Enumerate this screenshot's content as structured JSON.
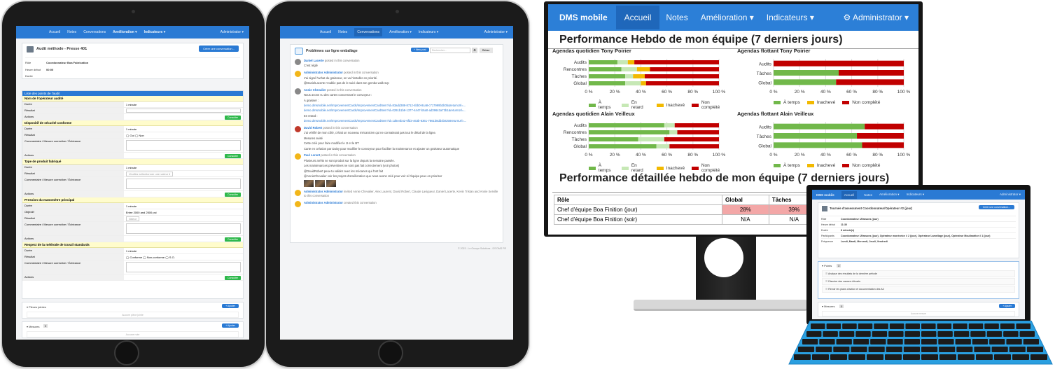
{
  "tablet1": {
    "nav": [
      "Accueil",
      "Notes",
      "Conversations",
      "Amélioration ▾",
      "Indicateurs ▾"
    ],
    "user": "Administrator ▾",
    "title": "Audit méthode - Presse 401",
    "create_btn": "Créer une conversation...",
    "role_label": "Rôle",
    "role_value": "Coordonnateur Boa Fabrication",
    "start_label": "Heure début",
    "start_value": "00:00",
    "duration_label": "Durée",
    "list_header": "Liste des points de l'audit",
    "sections": [
      {
        "title": "Nom de l'opérateur audité",
        "rows": [
          [
            "Durée",
            "1 minute"
          ],
          [
            "Résultat",
            ""
          ],
          [
            "Actions",
            ""
          ]
        ]
      },
      {
        "title": "Dispositif de sécurité conforme",
        "rows": [
          [
            "Durée",
            "1 minute"
          ],
          [
            "Résultat",
            "◯ Oui ◯ Non"
          ],
          [
            "Commentaire / Mesure corrective / Échéance",
            ""
          ],
          [
            "Actions",
            ""
          ]
        ]
      },
      {
        "title": "Type de produit fabriqué",
        "rows": [
          [
            "Durée",
            "1 minute"
          ],
          [
            "Résultat",
            "Veuillez sélectionner une valeur ▾"
          ],
          [
            "Commentaire / Mesure corrective / Échéance",
            ""
          ],
          [
            "Actions",
            ""
          ]
        ]
      },
      {
        "title": "Pression du manomètre principal",
        "rows": [
          [
            "Durée",
            "1 minute"
          ],
          [
            "Objectif",
            "Entre 2000 and 2500 psi"
          ],
          [
            "Résultat",
            "Valeur"
          ],
          [
            "Commentaire / Mesure corrective / Échéance",
            ""
          ],
          [
            "Actions",
            ""
          ]
        ]
      },
      {
        "title": "Respect de la méthode de travail standards",
        "rows": [
          [
            "Durée",
            "1 minute"
          ],
          [
            "Résultat",
            "◯ Conforme ◯ Non-conforme ◯ S.O."
          ],
          [
            "Commentaire / Mesure corrective / Échéance",
            ""
          ],
          [
            "Actions",
            ""
          ]
        ]
      }
    ],
    "consult": "Consulter",
    "pieces": "▾ Pièces jointes",
    "no_pieces": "Aucune pièce jointe",
    "mesures": "▾ Mesures",
    "mesures_count": "0",
    "no_mesures": "Aucune note",
    "add": "+ Ajouter"
  },
  "tablet2": {
    "nav": [
      "Accueil",
      "Notes",
      "Conversations",
      "Amélioration ▾",
      "Indicateurs ▾"
    ],
    "user": "Administrator ▾",
    "title": "Problèmes sur ligne emballage",
    "new_post": "+ New post",
    "search_placeholder": "Rechercher...",
    "back": "Retour",
    "posts": [
      {
        "author": "Daniel Lacerte",
        "meta": "posted in this conversation",
        "lines": [
          "C'est réglé"
        ],
        "color": "#888"
      },
      {
        "author": "Administrator Administrator",
        "meta": "posted in this conversation",
        "lines": [
          "J'ai signé l'achat du graisseur, on va l'installer en priorité.",
          "@DanielLacerte n'oublie pas de le suivi dans ton gemba walk svp"
        ],
        "color": "#f2b619"
      },
      {
        "author": "Annie Chevalier",
        "meta": "posted in this conversation",
        "lines": [
          "Nous avons vu des cartes concernant le convoyeur :",
          "À graisser :",
          "demo.dmsmobile.net/ImprovementCards/ImprovementCardItem?id=83add388-8712-4bb0-8ca8-c717999b2b0b&returnUrl=...",
          "demo.dmsmobile.net/ImprovementCards/ImprovementCardItem?id=0291b1b8-1377-4447-b5a0-ad39643a73b1&returnUrl=...",
          "En retard :",
          "demo.dmsmobile.net/ImprovementCards/ImprovementCardItem?id=1d6e4b42-0fd3-463b-8361-7861b8dd4b0258returnUrl=..."
        ],
        "color": "#888"
      },
      {
        "author": "David Robert",
        "meta": "posted in this conversation",
        "lines": [
          "J'ai vérifié de mon côté, c'était un nouveau mécanicien qui ne connaissait pas tout le détail de la ligne.",
          "Mesures avisé",
          "Cette créé pour faire modifier le JI et le BT",
          "Carte en création par Daisy pour modifier le convoyeur pour faciliter la maintenance et ajouter un graisseur automatique"
        ],
        "color": "#c0392b"
      },
      {
        "author": "Paul Lorent",
        "meta": "posted in this conversation",
        "lines": [
          "Plusieurs arrêts se sont produit sur la ligne depuis la semaine passée.",
          "Les maintenances préventives ne sont pas fait correctement (voir photos)",
          "@DavidRobert peux-tu valider avec les mécanos qui l'ont fait",
          "@AnnieChevalier voir les projets d'amélioration que nous avons créé pour voir si l'équipe peux en prioriser"
        ],
        "color": "#f2b619"
      },
      {
        "author": "Administrator Administrator",
        "meta": "invited Annie Chevalier, Alex Laurent, David Robert, Claude Lavigueur, Daniel Lacerte, Kevin Tristan and Annie Serville to this conversation",
        "lines": [],
        "color": "#f2b619"
      },
      {
        "author": "Administrator Administrator",
        "meta": "created this conversation",
        "lines": [],
        "color": "#f2b619"
      }
    ],
    "footer": "© 2023 - Le Groupe Solutions - DS DMS PR"
  },
  "monitor": {
    "brand": "DMS mobile",
    "nav": [
      "Accueil",
      "Notes",
      "Amélioration ▾",
      "Indicateurs ▾"
    ],
    "user": "⚙ Administrator ▾",
    "page_title": "Performance Hebdo de mon équipe (7 derniers jours)",
    "section2_title": "Performance détaillée hebdo de mon équipe (7 derniers jours)",
    "table_headers": [
      "Rôle",
      "Global",
      "Tâches"
    ],
    "table_rows": [
      [
        "Chef d'équipe Boa Finition (jour)",
        "28%",
        "39%"
      ],
      [
        "Chef d'équipe Boa Finition (soir)",
        "N/A",
        "N/A"
      ]
    ],
    "legend": {
      "on_time": "À temps",
      "late": "En retard",
      "incomplete": "Inachevé",
      "not_done": "Non complété"
    },
    "colors": {
      "on_time": "#71b84a",
      "late": "#c6e8b5",
      "incomplete": "#f2b900",
      "not_done": "#c10000"
    }
  },
  "chart_data": [
    {
      "type": "bar",
      "orientation": "horizontal",
      "stacked": true,
      "title": "Agendas quotidien Tony Poirier",
      "categories": [
        "Audits",
        "Rencontres",
        "Tâches",
        "Global"
      ],
      "xlim": [
        0,
        100
      ],
      "xticks": [
        "0 %",
        "20 %",
        "40 %",
        "60 %",
        "80 %",
        "100 %"
      ],
      "series": [
        {
          "name": "À temps",
          "values": [
            22,
            25,
            28,
            28
          ]
        },
        {
          "name": "En retard",
          "values": [
            8,
            12,
            6,
            12
          ]
        },
        {
          "name": "Inachevé",
          "values": [
            5,
            10,
            9,
            4
          ]
        },
        {
          "name": "Non complété",
          "values": [
            65,
            53,
            57,
            56
          ]
        }
      ]
    },
    {
      "type": "bar",
      "orientation": "horizontal",
      "stacked": true,
      "title": "Agendas flottant Tony Poirier",
      "categories": [
        "Audits",
        "Tâches",
        "Global"
      ],
      "xlim": [
        0,
        100
      ],
      "xticks": [
        "0 %",
        "20 %",
        "40 %",
        "60 %",
        "80 %",
        "100 %"
      ],
      "series": [
        {
          "name": "À temps",
          "values": [
            0,
            50,
            48
          ]
        },
        {
          "name": "Inachevé",
          "values": [
            0,
            0,
            0
          ]
        },
        {
          "name": "Non complété",
          "values": [
            100,
            50,
            52
          ]
        }
      ]
    },
    {
      "type": "bar",
      "orientation": "horizontal",
      "stacked": true,
      "title": "Agendas quotidien Alain Veilleux",
      "categories": [
        "Audits",
        "Rencontres",
        "Tâches",
        "Global"
      ],
      "xlim": [
        0,
        100
      ],
      "xticks": [
        "0 %",
        "20 %",
        "40 %",
        "60 %",
        "80 %",
        "100 %"
      ],
      "series": [
        {
          "name": "À temps",
          "values": [
            58,
            62,
            38,
            52
          ]
        },
        {
          "name": "En retard",
          "values": [
            8,
            6,
            20,
            10
          ]
        },
        {
          "name": "Inachevé",
          "values": [
            0,
            0,
            0,
            0
          ]
        },
        {
          "name": "Non complété",
          "values": [
            34,
            32,
            42,
            38
          ]
        }
      ]
    },
    {
      "type": "bar",
      "orientation": "horizontal",
      "stacked": true,
      "title": "Agendas flottant Alain Veilleux",
      "categories": [
        "Audits",
        "Tâches",
        "Global"
      ],
      "xlim": [
        0,
        100
      ],
      "xticks": [
        "0 %",
        "20 %",
        "40 %",
        "60 %",
        "80 %",
        "100 %"
      ],
      "series": [
        {
          "name": "À temps",
          "values": [
            70,
            64,
            68
          ]
        },
        {
          "name": "Inachevé",
          "values": [
            0,
            0,
            0
          ]
        },
        {
          "name": "Non complété",
          "values": [
            30,
            36,
            32
          ]
        }
      ]
    }
  ],
  "laptop": {
    "brand": "DMS mobile",
    "nav": [
      "Accueil",
      "Notes",
      "Amélioration ▾",
      "Indicateurs ▾"
    ],
    "user": "Administrator ▾",
    "title": "Tournée d'assessment Coordonnateur/Opérateur #2 (jour)",
    "create_btn": "Créer une conversation...",
    "fields": [
      [
        "Rôle",
        "Coordonnateur Ultrasons (jour)"
      ],
      [
        "Heure début",
        "11:30"
      ],
      [
        "Durée",
        "8 minute(s)"
      ],
      [
        "Participants",
        "Coordonnateur Ultrasons (jour), Opérateur monéorice # 2 (jour), Opérateur Lamellage (jour), Opérateur Moulisatrice # 1 (jour)"
      ],
      [
        "Fréquence",
        "Lundi, Mardi, Mercredi, Jeudi, Vendredi"
      ]
    ],
    "points_label": "▾ Points",
    "points_count": "3",
    "points": [
      "Analyse des résultats de la dernière période",
      "Discuter des causes d'écarts",
      "Revoir les plans d'action et documentation des A3"
    ],
    "mesures_label": "▾ Mesures",
    "mesures_count": "0",
    "add": "+ Ajouter",
    "no_mesures": "Aucune mesure"
  }
}
